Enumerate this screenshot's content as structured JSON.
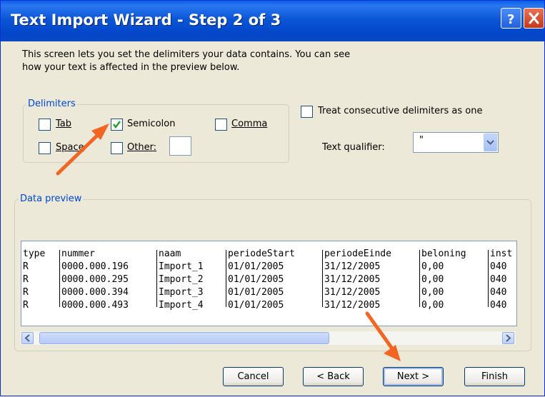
{
  "window": {
    "title": "Text Import Wizard - Step 2 of 3"
  },
  "intro": "This screen lets you set the delimiters your data contains.  You can see\nhow your text is affected in the preview below.",
  "delimiters": {
    "group_label": "Delimiters",
    "tab": {
      "label": "Tab",
      "checked": false
    },
    "semicolon": {
      "label": "Semicolon",
      "checked": true
    },
    "comma": {
      "label": "Comma",
      "checked": false
    },
    "space": {
      "label": "Space",
      "checked": false
    },
    "other": {
      "label": "Other:",
      "checked": false,
      "value": ""
    }
  },
  "consecutive": {
    "label": "Treat consecutive delimiters as one",
    "checked": false
  },
  "qualifier": {
    "label": "Text qualifier:",
    "value": "\""
  },
  "preview": {
    "group_label": "Data preview",
    "headers": [
      "type",
      "nummer",
      "naam",
      "periodeStart",
      "periodeEinde",
      "beloning",
      "inst"
    ],
    "rows": [
      [
        "R",
        "0000.000.196",
        "Import_1",
        "01/01/2005",
        "31/12/2005",
        "0,00",
        "040"
      ],
      [
        "R",
        "0000.000.295",
        "Import_2",
        "01/01/2005",
        "31/12/2005",
        "0,00",
        "040"
      ],
      [
        "R",
        "0000.000.394",
        "Import_3",
        "01/01/2005",
        "31/12/2005",
        "0,00",
        "040"
      ],
      [
        "R",
        "0000.000.493",
        "Import_4",
        "01/01/2005",
        "31/12/2005",
        "0,00",
        "040"
      ]
    ]
  },
  "buttons": {
    "cancel": "Cancel",
    "back": "< Back",
    "next": "Next >",
    "finish": "Finish"
  },
  "colors": {
    "titlebar": "#0a5fe8",
    "accent": "#0046d5",
    "annotation_arrow": "#f26522"
  }
}
